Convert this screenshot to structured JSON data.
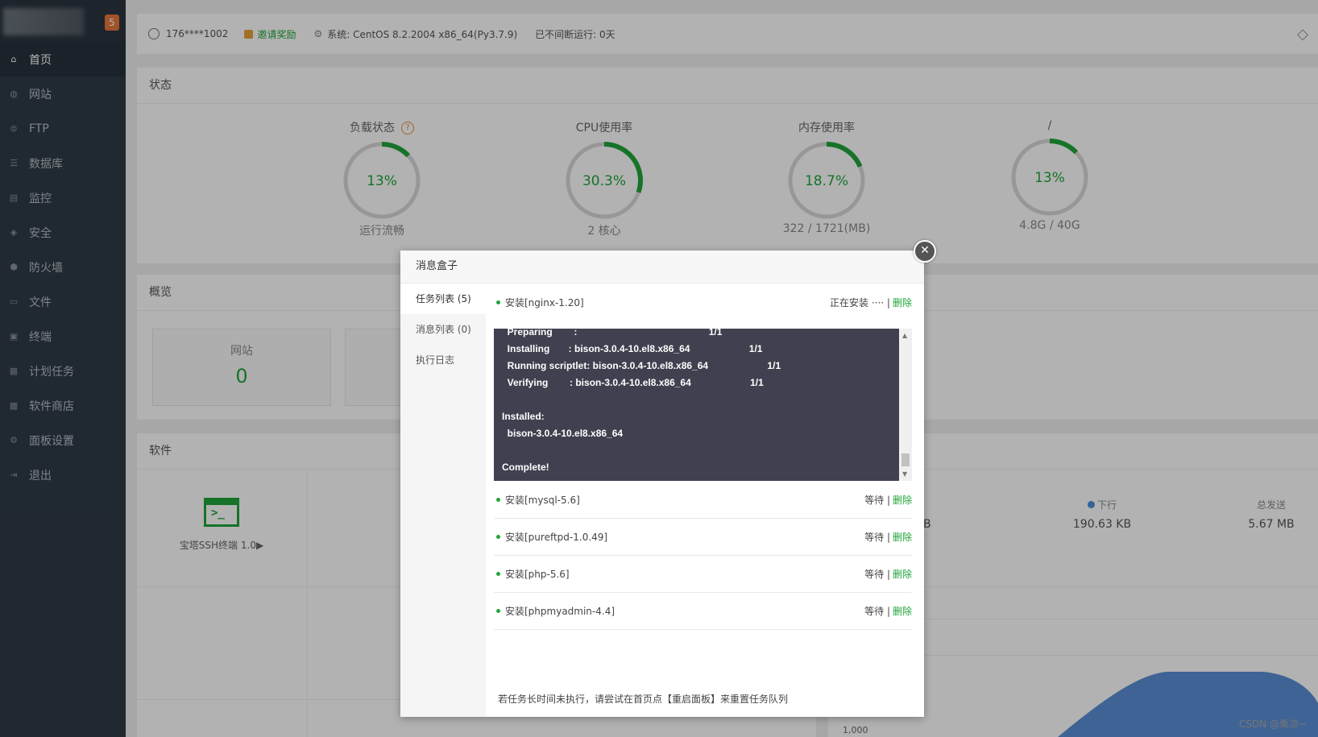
{
  "sidebar": {
    "badge": "5",
    "items": [
      {
        "label": "首页",
        "icon": "home-icon",
        "glyph": "⌂"
      },
      {
        "label": "网站",
        "icon": "globe-icon",
        "glyph": "◍"
      },
      {
        "label": "FTP",
        "icon": "ftp-icon",
        "glyph": "⊜"
      },
      {
        "label": "数据库",
        "icon": "database-icon",
        "glyph": "☰"
      },
      {
        "label": "监控",
        "icon": "monitor-icon",
        "glyph": "▤"
      },
      {
        "label": "安全",
        "icon": "shield-icon",
        "glyph": "◈"
      },
      {
        "label": "防火墙",
        "icon": "firewall-icon",
        "glyph": "⬢"
      },
      {
        "label": "文件",
        "icon": "folder-icon",
        "glyph": "▭"
      },
      {
        "label": "终端",
        "icon": "terminal-icon",
        "glyph": "▣"
      },
      {
        "label": "计划任务",
        "icon": "calendar-icon",
        "glyph": "▦"
      },
      {
        "label": "软件商店",
        "icon": "apps-icon",
        "glyph": "▩"
      },
      {
        "label": "面板设置",
        "icon": "settings-icon",
        "glyph": "⚙"
      },
      {
        "label": "退出",
        "icon": "logout-icon",
        "glyph": "⇥"
      }
    ]
  },
  "topbar": {
    "user": "176****1002",
    "invite": "邀请奖励",
    "system": "系统:  CentOS 8.2.2004 x86_64(Py3.7.9)",
    "uptime": "已不间断运行: 0天"
  },
  "status": {
    "title": "状态",
    "gauges": [
      {
        "label": "负载状态",
        "value": "13%",
        "sub": "运行流畅",
        "percent": 13,
        "help": "?"
      },
      {
        "label": "CPU使用率",
        "value": "30.3%",
        "sub": "2 核心",
        "percent": 30.3
      },
      {
        "label": "内存使用率",
        "value": "18.7%",
        "sub": "322 / 1721(MB)",
        "percent": 18.7
      },
      {
        "label": "/",
        "value": "13%",
        "sub": "4.8G / 40G",
        "percent": 13
      }
    ]
  },
  "overview": {
    "title": "概览",
    "website_label": "网站",
    "website_count": "0"
  },
  "software": {
    "title": "软件",
    "item": "宝塔SSH终端 1.0▶"
  },
  "disk": {
    "title": "磁盘IO",
    "partial_value": "B",
    "down_label": "下行",
    "down_value": "190.63 KB",
    "sent_label": "总发送",
    "sent_value": "5.67 MB",
    "axis_value": "1,000"
  },
  "modal": {
    "title": "消息盒子",
    "close": "✕",
    "tabs": [
      "任务列表 (5)",
      "消息列表 (0)",
      "执行日志"
    ],
    "current_task": {
      "name": "安装[nginx-1.20]",
      "status": "正在安装 ···· |",
      "delete": "删除"
    },
    "log_lines": [
      "  Preparing        :                                                 1/1",
      "  Installing       : bison-3.0.4-10.el8.x86_64                      1/1",
      "  Running scriptlet: bison-3.0.4-10.el8.x86_64                      1/1",
      "  Verifying        : bison-3.0.4-10.el8.x86_64                      1/1",
      "",
      "Installed:",
      "  bison-3.0.4-10.el8.x86_64",
      "",
      "Complete!"
    ],
    "tasks": [
      {
        "name": "安装[mysql-5.6]",
        "status": "等待 |",
        "delete": "删除"
      },
      {
        "name": "安装[pureftpd-1.0.49]",
        "status": "等待 |",
        "delete": "删除"
      },
      {
        "name": "安装[php-5.6]",
        "status": "等待 |",
        "delete": "删除"
      },
      {
        "name": "安装[phpmyadmin-4.4]",
        "status": "等待 |",
        "delete": "删除"
      }
    ],
    "footer": "若任务长时间未执行，请尝试在首页点【重启面板】来重置任务队列"
  },
  "watermark": "CSDN @乘凉~",
  "colors": {
    "accent": "#20a53a",
    "sidebar": "#2f3a45",
    "gauge_track": "#d9d9d9",
    "badge": "#e9763c"
  }
}
